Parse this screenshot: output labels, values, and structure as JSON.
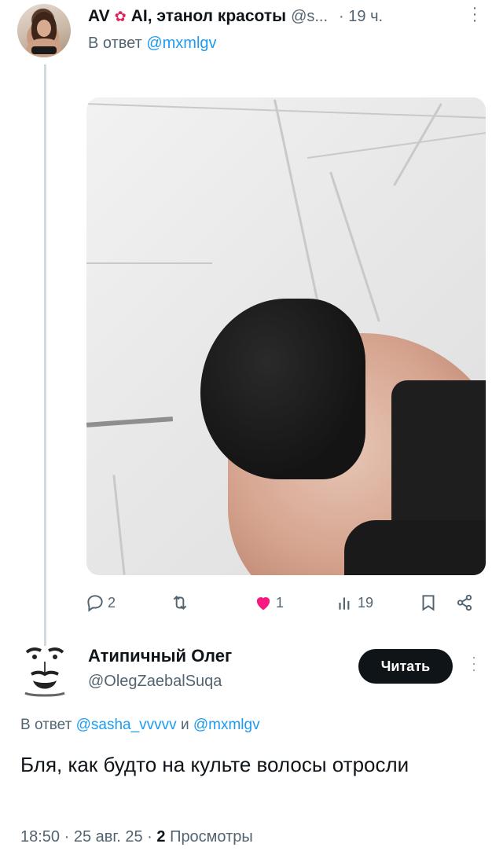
{
  "reply_tweet": {
    "author_name": "AV",
    "author_name_suffix": "AI, этанол красоты",
    "handle": "@s...",
    "time": "· 19 ч.",
    "reply_prefix": "В ответ",
    "reply_to": "@mxmlgv",
    "actions": {
      "replies": "2",
      "retweets": "",
      "likes": "1",
      "views": "19"
    }
  },
  "main_tweet": {
    "author_name": "Атипичный Олег",
    "handle": "@OlegZaebalSuqa",
    "follow_label": "Читать",
    "reply_prefix": "В ответ",
    "reply_to_1": "@sasha_vvvvv",
    "reply_conjunction": "и",
    "reply_to_2": "@mxmlgv",
    "text": "Бля, как будто на культе волосы отросли",
    "time": "18:50 · 25 авг. 25 ·",
    "views_count": "2",
    "views_label": "Просмотры"
  },
  "colors": {
    "accent_link": "#1d9bf0",
    "muted_text": "#536471",
    "like_pink": "#f91880",
    "follow_button": "#0f1419"
  },
  "icons": [
    "flower-icon",
    "more-icon",
    "reply-icon",
    "retweet-icon",
    "heart-icon",
    "views-icon",
    "bookmark-icon",
    "share-icon"
  ]
}
